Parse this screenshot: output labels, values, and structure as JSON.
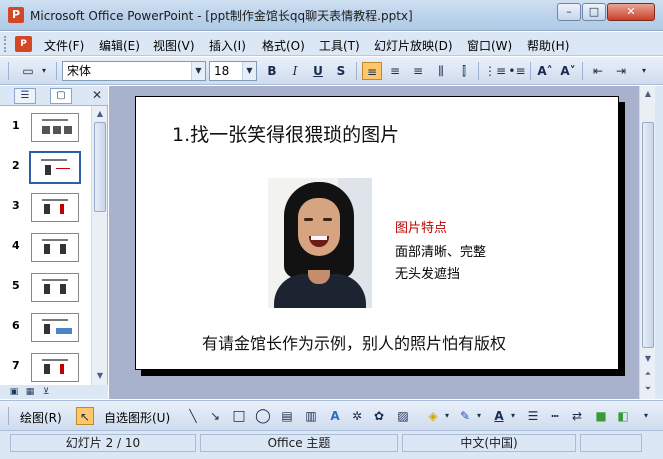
{
  "window": {
    "title": "Microsoft Office PowerPoint - [ppt制作金馆长qq聊天表情教程.pptx]",
    "minimize": "–",
    "maximize": "□",
    "close": "✕"
  },
  "menubar": {
    "items": [
      "文件(F)",
      "编辑(E)",
      "视图(V)",
      "插入(I)",
      "格式(O)",
      "工具(T)",
      "幻灯片放映(D)",
      "窗口(W)",
      "帮助(H)"
    ]
  },
  "toolbar": {
    "font_name": "宋体",
    "font_size": "18",
    "bold": "B",
    "italic": "I",
    "underline": "U",
    "shadow": "S",
    "align_left": "≡",
    "align_center": "≡",
    "align_right": "≡",
    "distribute": "⫼",
    "numbering": "⋮≡",
    "bullets": "•≡",
    "grow_font": "A˄",
    "shrink_font": "A˅",
    "decrease_indent": "⇤",
    "increase_indent": "⇥"
  },
  "left_pane": {
    "tab_outline": "☰",
    "tab_slides": "▢",
    "close": "✕",
    "thumbnails": [
      "1",
      "2",
      "3",
      "4",
      "5",
      "6",
      "7"
    ],
    "selected_index": 2
  },
  "slide": {
    "title": "1.找一张笑得很猥琐的图片",
    "feature_title": "图片特点",
    "feature_lines": [
      "面部清晰、完整",
      "无头发遮挡"
    ],
    "caption": "有请金馆长作为示例，别人的照片怕有版权"
  },
  "drawbar": {
    "draw_menu": "绘图(R)",
    "autoshapes": "自选图形(U)"
  },
  "status": {
    "slide_pos": "幻灯片 2 / 10",
    "theme": "Office 主题",
    "language": "中文(中国)"
  },
  "colors": {
    "feature_title": "#c00000",
    "workspace_bg": "#a9b2cc",
    "chrome": "#dce7f5"
  }
}
